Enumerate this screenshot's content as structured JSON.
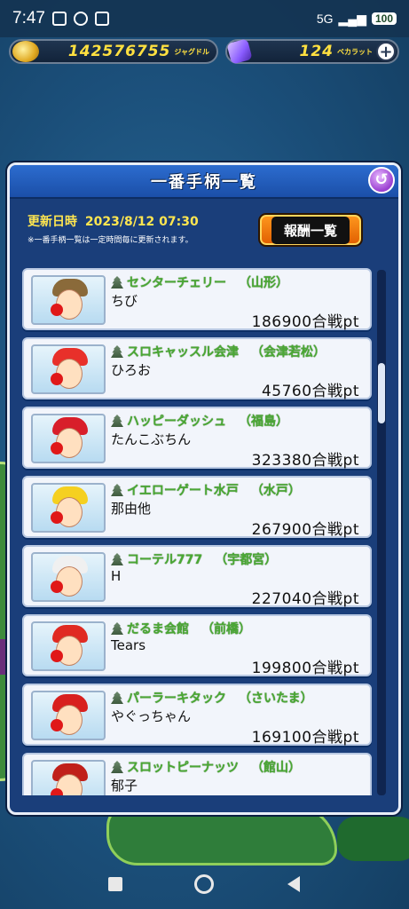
{
  "status_bar": {
    "time": "7:47",
    "network": "5G",
    "battery": "100"
  },
  "currency": {
    "gold_value": "142576755",
    "gold_unit": "ジャグドル",
    "gem_value": "124",
    "gem_unit": "ベカラット",
    "plus": "+"
  },
  "panel": {
    "title": "一番手柄一覧",
    "back": "↺",
    "update_label": "更新日時",
    "update_date": "2023/8/12 07:30",
    "note": "※一番手柄一覧は一定時間毎に更新されます。",
    "reward_button": "報酬一覧"
  },
  "entries": [
    {
      "shop": "センターチェリー",
      "area": "（山形）",
      "player": "ちび",
      "score": "186900合戦pt",
      "hat_color": "#8a6a3a"
    },
    {
      "shop": "スロキャッスル会津",
      "area": "（会津若松）",
      "player": "ひろお",
      "score": "45760合戦pt",
      "hat_color": "#e8302a"
    },
    {
      "shop": "ハッピーダッシュ",
      "area": "（福島）",
      "player": "たんこぶちん",
      "score": "323380合戦pt",
      "hat_color": "#d81e2a"
    },
    {
      "shop": "イエローゲート水戸",
      "area": "（水戸）",
      "player": "那由他",
      "score": "267900合戦pt",
      "hat_color": "#f5d020"
    },
    {
      "shop": "コーテル777",
      "area": "（宇都宮）",
      "player": "H",
      "score": "227040合戦pt",
      "hat_color": "#f0f0f0"
    },
    {
      "shop": "だるま会館",
      "area": "（前橋）",
      "player": "Tears",
      "score": "199800合戦pt",
      "hat_color": "#e02a22"
    },
    {
      "shop": "パーラーキタック",
      "area": "（さいたま）",
      "player": "やぐっちゃん",
      "score": "169100合戦pt",
      "hat_color": "#d8201e"
    },
    {
      "shop": "スロットピーナッツ",
      "area": "（館山）",
      "player": "郁子",
      "score": "",
      "hat_color": "#c0201a"
    }
  ],
  "scroll": {
    "position_fraction": 0.2
  }
}
